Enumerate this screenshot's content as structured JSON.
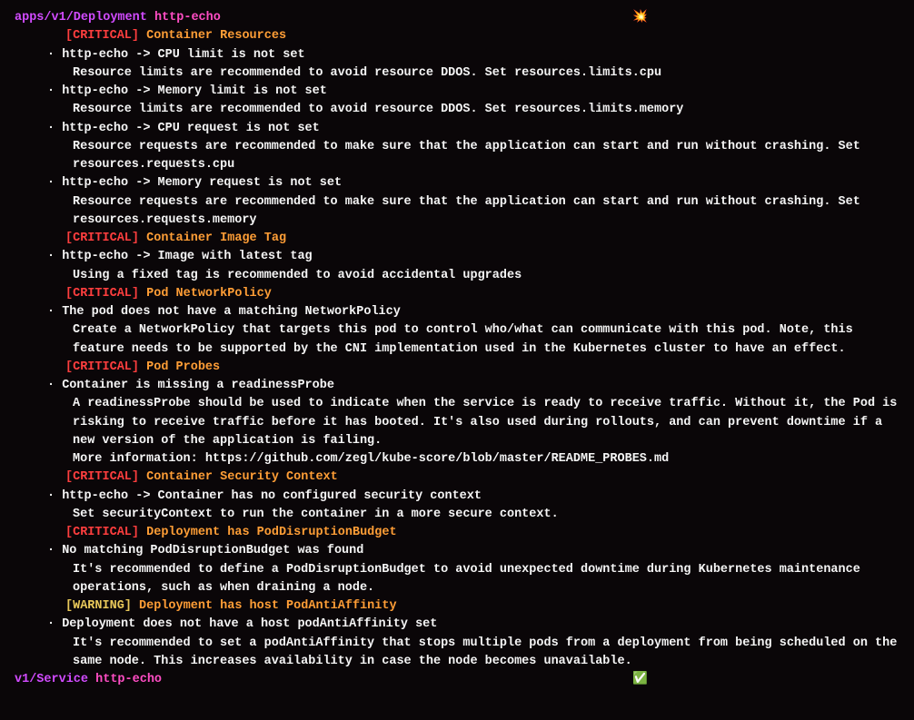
{
  "resources": [
    {
      "api": "apps/v1/Deployment",
      "name": "http-echo",
      "status_icon": "💥",
      "sections": [
        {
          "severity": "CRITICAL",
          "title": "Container Resources",
          "items": [
            {
              "summary": "http-echo -> CPU limit is not set",
              "desc": "Resource limits are recommended to avoid resource DDOS. Set resources.limits.cpu"
            },
            {
              "summary": "http-echo -> Memory limit is not set",
              "desc": "Resource limits are recommended to avoid resource DDOS. Set resources.limits.memory"
            },
            {
              "summary": "http-echo -> CPU request is not set",
              "desc": "Resource requests are recommended to make sure that the application can start and run without crashing. Set resources.requests.cpu"
            },
            {
              "summary": "http-echo -> Memory request is not set",
              "desc": "Resource requests are recommended to make sure that the application can start and run without crashing. Set resources.requests.memory"
            }
          ]
        },
        {
          "severity": "CRITICAL",
          "title": "Container Image Tag",
          "items": [
            {
              "summary": "http-echo -> Image with latest tag",
              "desc": "Using a fixed tag is recommended to avoid accidental upgrades"
            }
          ]
        },
        {
          "severity": "CRITICAL",
          "title": "Pod NetworkPolicy",
          "items": [
            {
              "summary": "The pod does not have a matching NetworkPolicy",
              "desc": "Create a NetworkPolicy that targets this pod to control who/what can communicate with this pod. Note, this feature needs to be supported by the CNI implementation used in the Kubernetes cluster to have an effect."
            }
          ]
        },
        {
          "severity": "CRITICAL",
          "title": "Pod Probes",
          "items": [
            {
              "summary": "Container is missing a readinessProbe",
              "desc": "A readinessProbe should be used to indicate when the service is ready to receive traffic. Without it, the Pod is risking to receive traffic before it has booted. It's also used during rollouts, and can prevent downtime if a new version of the application is failing.\nMore information: https://github.com/zegl/kube-score/blob/master/README_PROBES.md"
            }
          ]
        },
        {
          "severity": "CRITICAL",
          "title": "Container Security Context",
          "items": [
            {
              "summary": "http-echo -> Container has no configured security context",
              "desc": "Set securityContext to run the container in a more secure context."
            }
          ]
        },
        {
          "severity": "CRITICAL",
          "title": "Deployment has PodDisruptionBudget",
          "items": [
            {
              "summary": "No matching PodDisruptionBudget was found",
              "desc": "It's recommended to define a PodDisruptionBudget to avoid unexpected downtime during Kubernetes maintenance operations, such as when draining a node."
            }
          ]
        },
        {
          "severity": "WARNING",
          "title": "Deployment has host PodAntiAffinity",
          "items": [
            {
              "summary": "Deployment does not have a host podAntiAffinity set",
              "desc": "It's recommended to set a podAntiAffinity that stops multiple pods from a deployment from being scheduled on the same node. This increases availability in case the node becomes unavailable."
            }
          ]
        }
      ]
    },
    {
      "api": "v1/Service",
      "name": "http-echo",
      "status_icon": "✅",
      "sections": []
    }
  ]
}
